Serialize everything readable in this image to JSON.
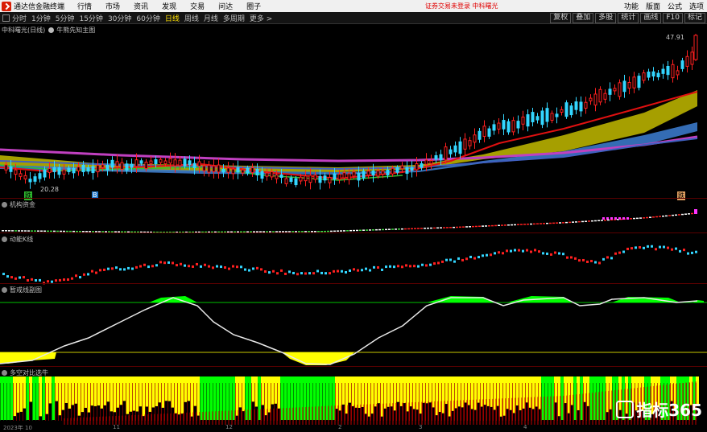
{
  "menubar": {
    "app_title": "通达信金融终端",
    "items": [
      "行情",
      "市场",
      "资讯",
      "发现",
      "交易",
      "问达",
      "圈子"
    ],
    "notice": "证券交易未登录  中科曙光",
    "right": [
      "功能",
      "版面",
      "公式",
      "选项"
    ]
  },
  "toolbar": {
    "periods": [
      "分时",
      "1分钟",
      "5分钟",
      "15分钟",
      "30分钟",
      "60分钟",
      "日线",
      "周线",
      "月线",
      "多周期",
      "更多 >"
    ],
    "active_period": "日线",
    "right": [
      "复权",
      "叠加",
      "多股",
      "统计",
      "画线",
      "F10",
      "标记"
    ]
  },
  "stock": {
    "name": "中科曙光(日线)",
    "indicator": "牛熊先知主图"
  },
  "price_labels": {
    "high": "47.91",
    "low": "20.28"
  },
  "markers": {
    "left": "跌",
    "mid": "B",
    "right": "跌"
  },
  "panels": [
    "机构资金",
    "动能K线",
    "暂戒线副图",
    "多空对比选牛"
  ],
  "xaxis": [
    "2023年 10",
    "11",
    "12",
    "2",
    "3",
    "4"
  ],
  "watermark": "指标365",
  "colors": {
    "up": "#ff2020",
    "down": "#33d6ff",
    "yellow": "#ffff00",
    "green": "#00ff00",
    "accent": "#ffe000"
  }
}
